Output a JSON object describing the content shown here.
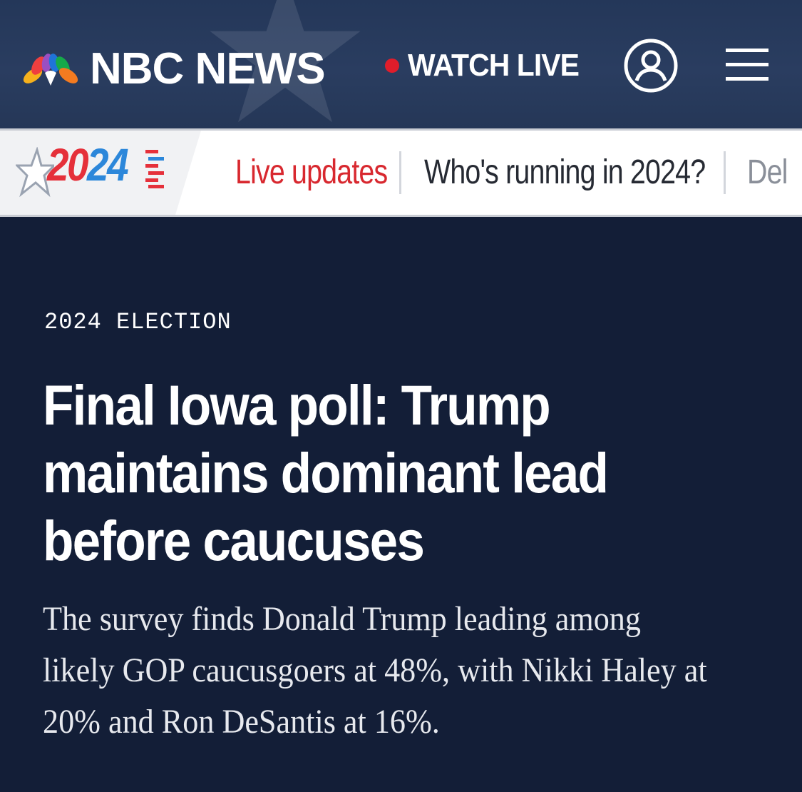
{
  "header": {
    "brand": "NBC NEWS",
    "watch_live_label": "WATCH LIVE",
    "icons": {
      "logo": "nbc-peacock-icon",
      "account": "user-account-icon",
      "menu": "hamburger-menu-icon"
    },
    "colors": {
      "background": "#253757",
      "live_dot": "#e01d2b"
    }
  },
  "election_nav": {
    "badge_year_red": "20",
    "badge_year_blue": "24",
    "items": [
      {
        "label": "Live updates"
      },
      {
        "label": "Who's running in 2024?"
      },
      {
        "label": "Del"
      }
    ],
    "colors": {
      "live_updates": "#d8282f",
      "default": "#262a33",
      "faded": "#8a8f99"
    }
  },
  "article": {
    "kicker": "2024 ELECTION",
    "headline_lines": [
      "Final Iowa poll: Trump",
      "maintains dominant lead",
      "before caucuses"
    ],
    "dek_lines": [
      "The survey finds Donald Trump leading among",
      "likely GOP caucusgoers at 48%, with Nikki Haley at",
      "20% and Ron DeSantis at 16%."
    ],
    "colors": {
      "background": "#131e37",
      "text": "#ffffff"
    }
  }
}
